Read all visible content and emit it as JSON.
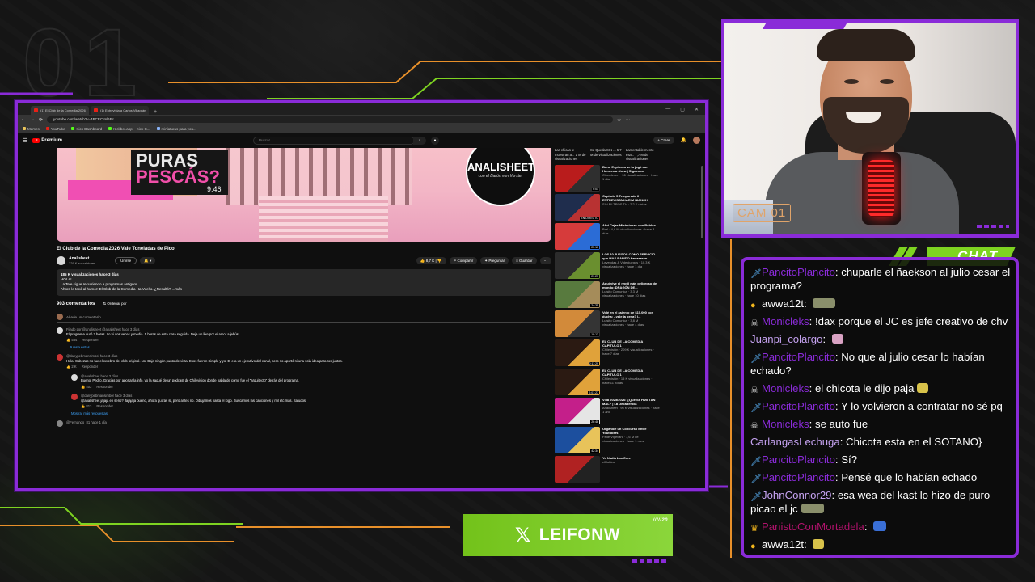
{
  "overlay": {
    "bg_number": "01",
    "cam_label": "CAM 01",
    "chat_title": "CHAT",
    "twitter_handle": "LEIFONW",
    "twitter_tag": "/////20",
    "accent_color": "#8a2bd8",
    "green_color": "#7ed321"
  },
  "browser": {
    "tabs": [
      "(1) El Club de la Comedia 2026",
      "(1) Entrevista a Carlos Villagrán"
    ],
    "url": "youtube.com/watch?v=4PCECIml6Pc",
    "bookmarks": [
      "Memes",
      "YouTube",
      "Kick Dashboard",
      "Kickbot.app – Kick C...",
      "miniaturas para you..."
    ]
  },
  "youtube": {
    "brand": "Premium",
    "search_placeholder": "Buscar",
    "create_label": "Crear",
    "thumb_text_line1": "PURAS",
    "thumb_text_line2": "PESCÁS?",
    "thumb_time": "9:46",
    "logo_name": "ANALISHEET",
    "logo_sub": "con el Barón von Vorster",
    "video_title": "El Club de la Comedia 2026 Vale Toneladas de Pico.",
    "channel_name": "Analisheet",
    "channel_subs": "229 K suscriptores",
    "join_label": "Unirse",
    "subscribed_label": "Suscrito",
    "likes": "8,7 K",
    "share_label": "Compartir",
    "ask_label": "Preguntar",
    "save_label": "Guardar",
    "desc_stats": "185 K visualizaciones  hace 3 días",
    "desc_line1": "HOLA!",
    "desc_line2": "La Tele sigue recurriendo a programas antiguos",
    "desc_line3": "Ahora le tocó al humor: El Club de la Comedia Ha Vuelto. ¿Resultó? ...más",
    "comments_count": "903 comentarios",
    "sort_label": "Ordenar por",
    "add_comment": "Añade un comentario...",
    "comments": [
      {
        "user": "Fijado por @analisheet  @analisheet  hace 3 días",
        "text": "El programa duró 2 horas. Lo vi dos veces y media. 5 horas de esta cosa seguida. Deja un like por el amor a jebús",
        "likes": "584",
        "reply": "Responder",
        "replies": "9 respuestas"
      },
      {
        "user": "@danypebmansimbol  hace 3 días",
        "text": "Hola. Cabezas no fue el cerebro del club original. No. Bajo ningún punto de vista. Esos fueron Simple y yo. El era un ejecutivo del canal, pero no aportó ni una sola idea para ser justos.",
        "likes": "2 K",
        "reply": "Responder"
      },
      {
        "user": "@analisheet  hace 3 días",
        "text": "Bueno, Pedro. Gracias por aportar la info, yo la saqué de un podcast de Chilevision donde habla de como fue el \"arquitecto\" detrás del programa.",
        "likes": "403",
        "reply": "Responder"
      },
      {
        "user": "@danypebmansimbol  hace 3 días",
        "text": "@analisheet jajaja en serio? Jajajaja bueno, ahora quizás sí, pero antes no. Dibujamos hasta el logo. Buscamos las canciones y mil etc más. Saludos!",
        "likes": "813",
        "reply": "Responder"
      },
      {
        "user": "@Fernando_81  hace 1 día",
        "text": "",
        "likes": "",
        "reply": ""
      }
    ],
    "more_replies": "Mostrar más respuestas",
    "chips": [
      "Las chicas le muestran a... 1 M de visualizaciones",
      "Se Queda SIN ... 5,7 M de visualizaciones",
      "Lamentable mente esa... 7,7 M de visualizaciones"
    ],
    "sidebar": [
      {
        "title": "Bono Espinoza se la jugó con Homenda show | Siguenos",
        "meta": "Ciberdesert · 96 visualizaciones · hace 1 día",
        "dur": "6:01",
        "c1": "#b91c1c",
        "c2": "#2f2f2f"
      },
      {
        "title": "Capitulo 5 Temporada 6 ENTREVISTA KARIM BIANCHI",
        "meta": "SIN FILTROS TV · 2,2 K vistas",
        "dur": "EN DIRECTO",
        "c1": "#1f2d4d",
        "c2": "#b83232"
      },
      {
        "title": "Abri Cajas Misteriosas con Roblox",
        "meta": "Brel · 4,8 M visualizaciones · hace 8 días",
        "dur": "23:10",
        "c1": "#d63b3b",
        "c2": "#2b6cd6"
      },
      {
        "title": "LOS 10 JUEGOS COMO SERVICIO que MAS RAPIDO fracasaron",
        "meta": "Leyendas & Videojuegos · 10,3 K visualizaciones · hace 1 día",
        "dur": "29:27",
        "c1": "#2c2c2c",
        "c2": "#6a8f2f"
      },
      {
        "title": "Aquí vive el reptil más peligroso del mundo: DRAGÓN DE...",
        "meta": "Luisito Comunica · 3,3 M visualizaciones · hace 10 días",
        "dur": "24:35",
        "c1": "#587a3e",
        "c2": "#a58c5a"
      },
      {
        "title": "Volé en el asiento de $15,000 con ducha: ¿vale la pena? |...",
        "meta": "Luisito Comunica · 3,8 M visualizaciones · hace 4 días",
        "dur": "18:13",
        "c1": "#d28a3a",
        "c2": "#343434"
      },
      {
        "title": "EL CLUB DE LA COMEDIA CAPÍTULO 1",
        "meta": "Chilevisión · 209 K visualizaciones · hace 7 días",
        "dur": "2:11:29",
        "c1": "#2b1a12",
        "c2": "#e0a23a"
      },
      {
        "title": "EL CLUB DE LA COMEDIA CAPÍTULO 1",
        "meta": "Chilevisión · 15 K visualizaciones · hace 11 horas",
        "dur": "2:01:27",
        "c1": "#2b1a12",
        "c2": "#e0a23a"
      },
      {
        "title": "Villa 2025/2026: ¿Qué Se Hizo TAN MAL? | La Decadencia",
        "meta": "Analisheet · 96 K visualizaciones · hace 1 año",
        "dur": "26:46",
        "c1": "#c41f8a",
        "c2": "#e5e5e5"
      },
      {
        "title": "Organicé un Concurso Entre Youtubers",
        "meta": "Fede Vigevani · 1,6 M de visualizaciones · hace 1 mes",
        "dur": "42:34",
        "c1": "#1c4f9e",
        "c2": "#e8c35a"
      },
      {
        "title": "Yo Nadia Las Cree",
        "meta": "elRubius",
        "dur": "",
        "c1": "#b02222",
        "c2": "#222"
      }
    ]
  },
  "chat": [
    {
      "user": "PancitoPlancito",
      "ucolor": "#8a2bd8",
      "badge": "sword",
      "text": "chuparle el ñaekson al julio cesar el programa?"
    },
    {
      "user": "awwa12t",
      "ucolor": "#ffffff",
      "badge": "coin",
      "text": "",
      "emote": "cat"
    },
    {
      "user": "Monicleks",
      "ucolor": "#8a2bd8",
      "badge": "skull",
      "text": "!dax porque el JC es jefe creativo de chv"
    },
    {
      "user": "Juanpi_colargo",
      "ucolor": "#c5a2f0",
      "badge": "",
      "text": "",
      "emote": "mouse"
    },
    {
      "user": "PancitoPlancito",
      "ucolor": "#8a2bd8",
      "badge": "sword",
      "text": "No que al julio cesar lo habían echado?"
    },
    {
      "user": "Monicleks",
      "ucolor": "#8a2bd8",
      "badge": "skull",
      "text": "el chicota le dijo paja",
      "emote": "face"
    },
    {
      "user": "PancitoPlancito",
      "ucolor": "#8a2bd8",
      "badge": "sword",
      "text": "Y lo volvieron a contratar no sé pq"
    },
    {
      "user": "Monicleks",
      "ucolor": "#8a2bd8",
      "badge": "skull",
      "text": "se auto fue"
    },
    {
      "user": "CarlangasLechuga",
      "ucolor": "#c5a2f0",
      "badge": "",
      "text": "Chicota esta en el SOTANO}"
    },
    {
      "user": "PancitoPlancito",
      "ucolor": "#8a2bd8",
      "badge": "sword",
      "text": "Sí?"
    },
    {
      "user": "PancitoPlancito",
      "ucolor": "#8a2bd8",
      "badge": "sword",
      "text": "Pensé que lo habían echado"
    },
    {
      "user": "JohnConnor29",
      "ucolor": "#c5a2f0",
      "badge": "sword",
      "text": "esa wea del kast lo hizo de puro picao el jc",
      "emote": "cat"
    },
    {
      "user": "PanistoConMortadela",
      "ucolor": "#b0126b",
      "badge": "crown",
      "text": "",
      "emote": "flag"
    },
    {
      "user": "awwa12t",
      "ucolor": "#ffffff",
      "badge": "coin",
      "text": "",
      "emote": "face"
    }
  ]
}
